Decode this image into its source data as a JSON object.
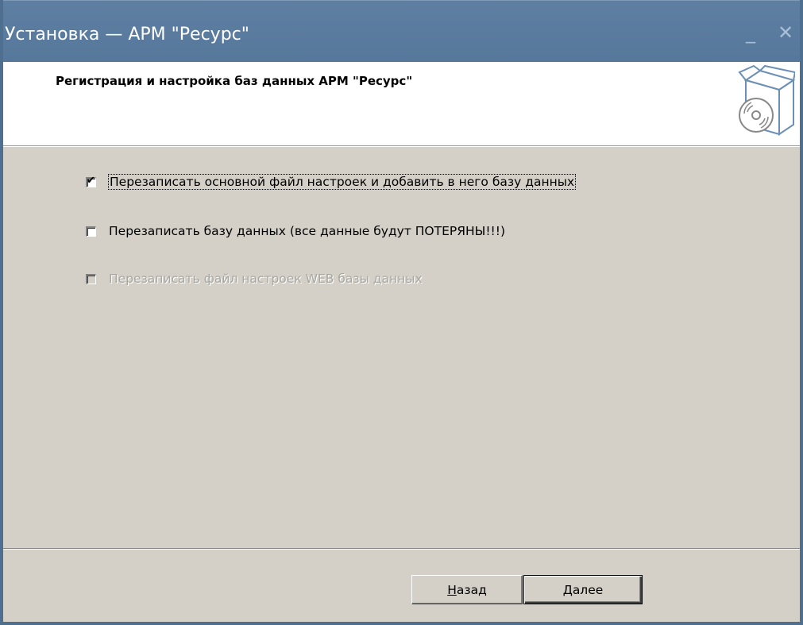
{
  "window": {
    "title": "Установка — АРМ \"Ресурс\"",
    "minimize_glyph": "_",
    "close_glyph": "✕"
  },
  "header": {
    "title": "Регистрация и настройка баз данных АРМ \"Ресурс\"",
    "icon": "package-box-disc-icon"
  },
  "options": [
    {
      "label": "Перезаписать основной файл настроек и добавить в него базу данных",
      "checked": true,
      "enabled": true,
      "focused": true
    },
    {
      "label": "Перезаписать базу данных (все данные будут ПОТЕРЯНЫ!!!)",
      "checked": false,
      "enabled": true,
      "focused": false
    },
    {
      "label": "Перезаписать файл настроек WEB базы данных",
      "checked": false,
      "enabled": false,
      "focused": false
    }
  ],
  "buttons": {
    "back_accel": "Н",
    "back_rest": "азад",
    "next_accel": "Д",
    "next_rest": "алее"
  },
  "colors": {
    "titlebar": "#5a7b9e",
    "dialog_bg": "#d4d0c8",
    "header_bg": "#ffffff",
    "disabled_text": "#a8a6a0"
  }
}
